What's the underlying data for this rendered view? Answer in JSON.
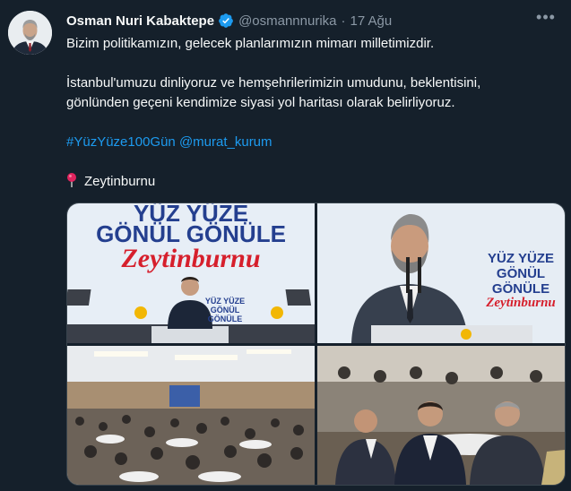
{
  "author": {
    "name": "Osman Nuri Kabaktepe",
    "handle": "@osmannnurika",
    "separator": "·",
    "date": "17 Ağu"
  },
  "tweet": {
    "line1": "Bizim politikamızın, gelecek planlarımızın mimarı milletimizdir.",
    "line2": "İstanbul'umuzu dinliyoruz ve hemşehrilerimizin umudunu, beklentisini,",
    "line3": "gönlünden geçeni kendimize siyasi yol haritası olarak belirliyoruz.",
    "hashtag": "#YüzYüze100Gün",
    "mention": "@murat_kurum",
    "location": "Zeytinburnu"
  },
  "banner1": {
    "line1": "YÜZ YÜZE",
    "line2": "GÖNÜL GÖNÜLE",
    "line3": "Zeytinburnu"
  },
  "banner2": {
    "line1": "YÜZ YÜZE",
    "line2": "GÖNÜL",
    "line3": "GÖNÜLE",
    "line4": "Zeytinburnu"
  },
  "colors": {
    "background": "#15202b",
    "text": "#f7f9f9",
    "muted": "#8b98a5",
    "link": "#1d9bf0",
    "verified": "#1d9bf0"
  }
}
